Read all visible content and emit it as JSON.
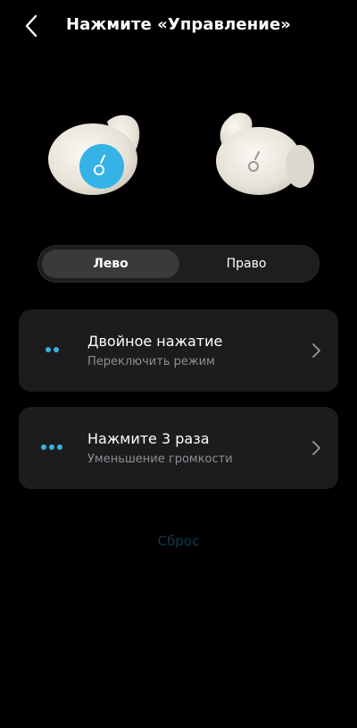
{
  "header": {
    "title": "Нажмите «Управление»",
    "back_icon": "chevron-left-icon"
  },
  "earbuds": {
    "left_logo_color": "#36b3e6",
    "right_logo_color": "#9a9a96",
    "body_color": "#ece8df"
  },
  "segment": {
    "left_label": "Лево",
    "right_label": "Право",
    "selected": "Лево"
  },
  "controls": [
    {
      "title": "Двойное нажатие",
      "subtitle": "Переключить режим",
      "dots": 2
    },
    {
      "title": "Нажмите 3 раза",
      "subtitle": "Уменьшение громкости",
      "dots": 3
    }
  ],
  "reset_label": "Сброс",
  "colors": {
    "accent": "#36b3e6",
    "card_bg": "#1c1c1e",
    "background": "#000000",
    "subtitle": "#8e8e93"
  }
}
